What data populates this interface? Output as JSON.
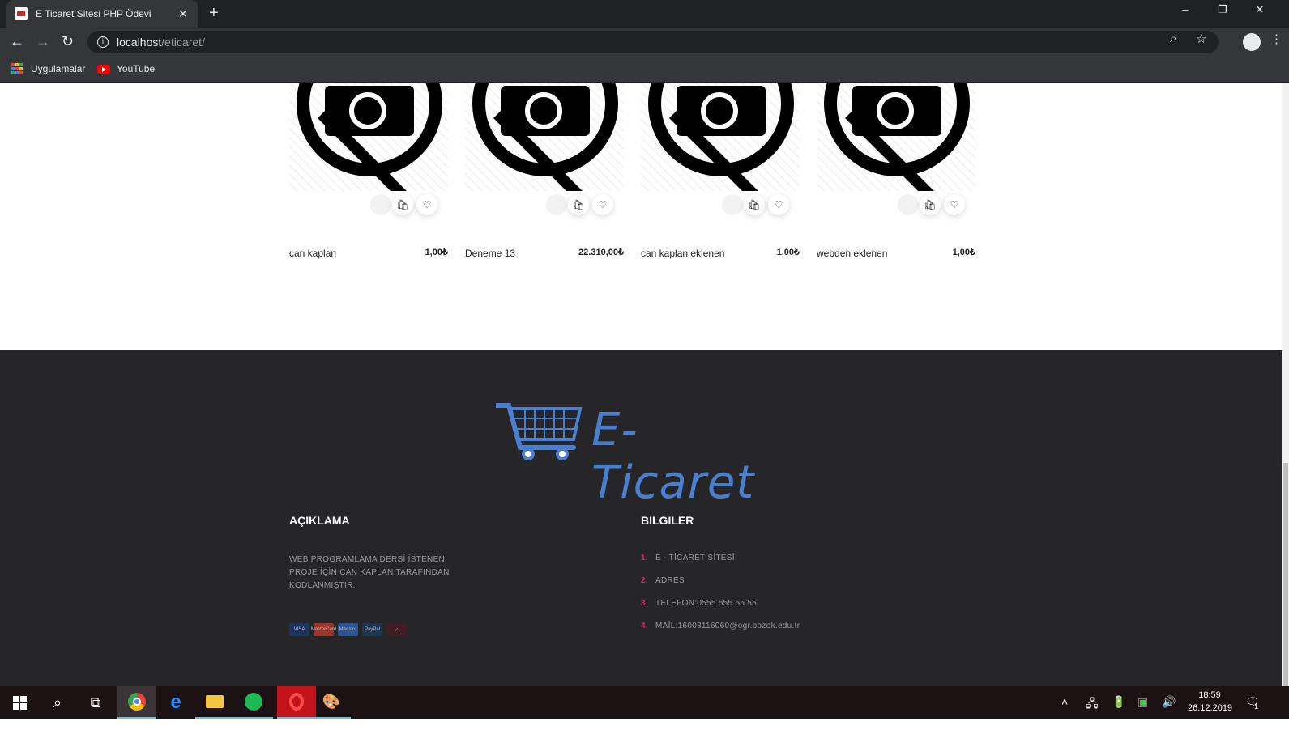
{
  "browser": {
    "tab_title": "E Ticaret Sitesi PHP Ödevi",
    "tab_close": "✕",
    "new_tab": "+",
    "window_minimize": "–",
    "window_restore": "❐",
    "window_close": "✕",
    "url_host": "localhost",
    "url_path": "/eticaret/",
    "bookmarks": [
      {
        "label": "Uygulamalar",
        "icon": "apps-grid-icon"
      },
      {
        "label": "YouTube",
        "icon": "youtube-icon"
      }
    ]
  },
  "products": [
    {
      "name": "can kaplan",
      "price": "1,00₺"
    },
    {
      "name": "Deneme 13",
      "price": "22.310,00₺"
    },
    {
      "name": "can kaplan eklenen",
      "price": "1,00₺"
    },
    {
      "name": "webden eklenen",
      "price": "1,00₺"
    }
  ],
  "footer": {
    "logo_text": "E-Ticaret",
    "brand_color": "#4a7fd0",
    "accent_color": "#e0245e",
    "about_title": "AÇIKLAMA",
    "about_text": "WEB PROGRAMLAMA DERSİ İSTENEN PROJE İÇİN CAN KAPLAN TARAFINDAN KODLANMIŞTIR.",
    "payments": [
      "VISA",
      "MasterCard",
      "Maestro",
      "PayPal",
      "✓"
    ],
    "info_title": "BILGILER",
    "info_items": [
      {
        "num": "1.",
        "text": "E - TİCARET SİTESİ"
      },
      {
        "num": "2.",
        "text": "ADRES"
      },
      {
        "num": "3.",
        "text": "TELEFON:0555 555 55 55"
      },
      {
        "num": "4.",
        "text": "MAİL:16008116060@ogr.bozok.edu.tr"
      }
    ]
  },
  "taskbar": {
    "time": "18:59",
    "date": "26.12.2019",
    "notification_count": "1"
  }
}
